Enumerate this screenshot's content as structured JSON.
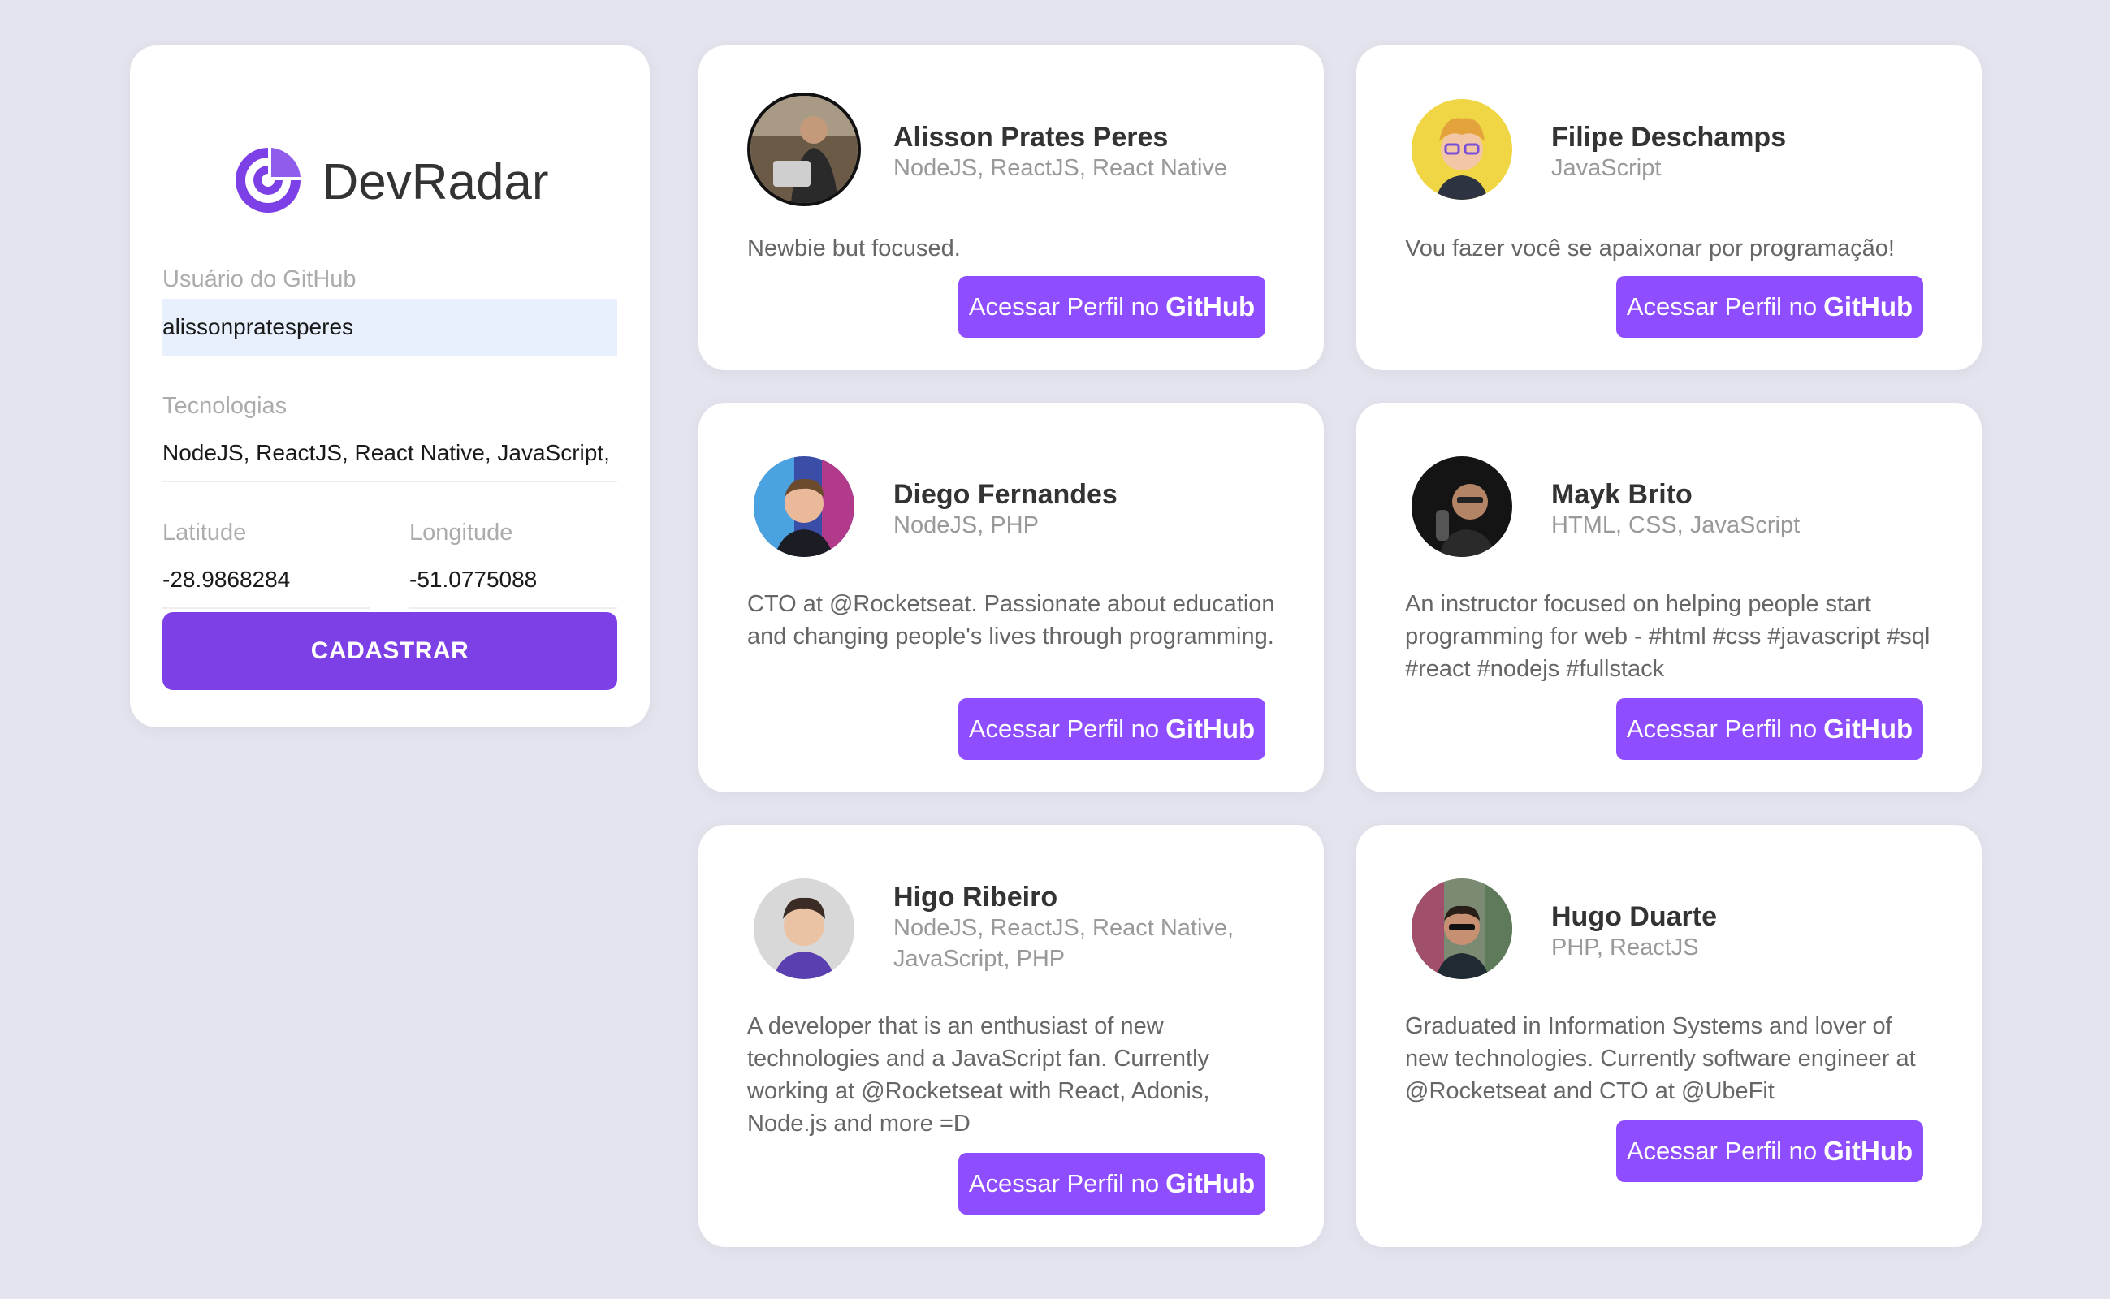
{
  "app": {
    "brand_name": "DevRadar",
    "accent_color": "#7d40e7",
    "button_color": "#8e4dff"
  },
  "form": {
    "github_user_label": "Usuário do GitHub",
    "github_user_value": "alissonpratesperes",
    "techs_label": "Tecnologias",
    "techs_value": "NodeJS, ReactJS, React Native, JavaScript, PHP",
    "latitude_label": "Latitude",
    "latitude_value": "-28.9868284",
    "longitude_label": "Longitude",
    "longitude_value": "-51.0775088",
    "submit_label": "CADASTRAR"
  },
  "devs": [
    {
      "name": "Alisson Prates Peres",
      "techs": "NodeJS, ReactJS, React Native",
      "bio": "Newbie but focused.",
      "button_prefix": "Acessar Perfil no",
      "button_brand": "GitHub"
    },
    {
      "name": "Filipe Deschamps",
      "techs": "JavaScript",
      "bio": "Vou fazer você se apaixonar por programação!",
      "button_prefix": "Acessar Perfil no",
      "button_brand": "GitHub"
    },
    {
      "name": "Diego Fernandes",
      "techs": "NodeJS, PHP",
      "bio": "CTO at @Rocketseat. Passionate about education and changing people's lives through programming.",
      "button_prefix": "Acessar Perfil no",
      "button_brand": "GitHub"
    },
    {
      "name": "Mayk Brito",
      "techs": "HTML, CSS, JavaScript",
      "bio": "An instructor focused on helping people start programming for web - #html #css #javascript #sql #react #nodejs #fullstack",
      "button_prefix": "Acessar Perfil no",
      "button_brand": "GitHub"
    },
    {
      "name": "Higo Ribeiro",
      "techs": "NodeJS, ReactJS, React Native, JavaScript, PHP",
      "bio": "A developer that is an enthusiast of new technologies and a JavaScript fan. Currently working at @Rocketseat with React, Adonis, Node.js and more =D",
      "button_prefix": "Acessar Perfil no",
      "button_brand": "GitHub"
    },
    {
      "name": "Hugo Duarte",
      "techs": "PHP, ReactJS",
      "bio": "Graduated in Information Systems and lover of new technologies. Currently software engineer at @Rocketseat and CTO at @UbeFit",
      "button_prefix": "Acessar Perfil no",
      "button_brand": "GitHub"
    }
  ]
}
